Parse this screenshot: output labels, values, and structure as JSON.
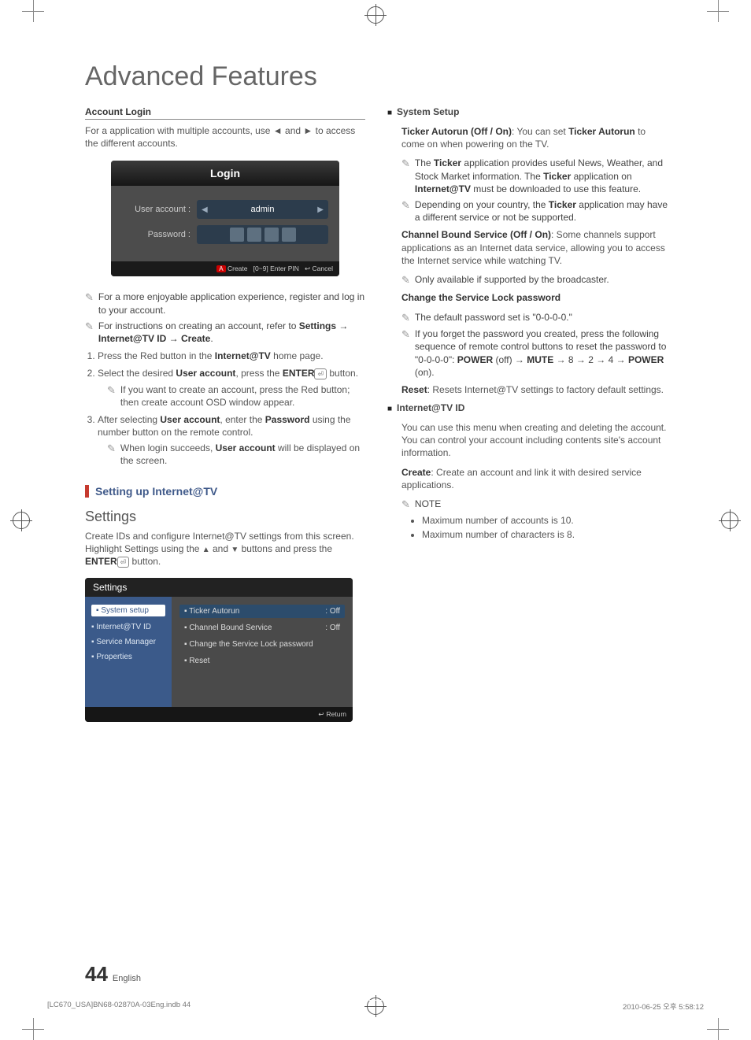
{
  "page_title": "Advanced Features",
  "left": {
    "account_login_heading": "Account Login",
    "account_login_intro_a": "For a application with multiple accounts, use ",
    "arrow_l": "◄",
    "account_login_intro_b": " and ",
    "arrow_r": "►",
    "account_login_intro_c": " to access the different accounts.",
    "login_box": {
      "title": "Login",
      "user_label": "User account :",
      "user_value": "admin",
      "pw_label": "Password :",
      "footer_a": "A",
      "footer_create": " Create",
      "footer_pin": "[0~9] Enter PIN",
      "footer_cancel_icon": "↩",
      "footer_cancel": " Cancel"
    },
    "notes": [
      "For a more enjoyable application experience, register and log in to your account.",
      "For instructions on creating an account, refer to Settings → Internet@TV ID → Create."
    ],
    "note2_bold": "Settings → Internet@TV ID → Create",
    "steps": {
      "s1_a": "Press the Red button in the ",
      "s1_b": "Internet@TV",
      "s1_c": " home page.",
      "s2_a": "Select the desired ",
      "s2_b": "User account",
      "s2_c": ", press the ",
      "s2_d": "ENTER",
      "s2_e": " button.",
      "s2_note": "If you want to create an account, press the Red button; then create account OSD window appear.",
      "s3_a": "After selecting ",
      "s3_b": "User account",
      "s3_c": ", enter the ",
      "s3_d": "Password",
      "s3_e": " using the number button on the remote control.",
      "s3_note_a": "When login succeeds, ",
      "s3_note_b": "User account",
      "s3_note_c": " will be displayed on the screen."
    },
    "section_header": "Setting up Internet@TV",
    "settings_title": "Settings",
    "settings_intro_a": "Create IDs and configure Internet@TV settings from this screen. Highlight Settings using the ",
    "up": "▲",
    "settings_intro_b": " and ",
    "dn": "▼",
    "settings_intro_c": " buttons and press the ",
    "settings_intro_d": "ENTER",
    "settings_intro_e": " button.",
    "settings_panel": {
      "header": "Settings",
      "nav": [
        "System setup",
        "Internet@TV ID",
        "Service Manager",
        "Properties"
      ],
      "rows": [
        {
          "label": "Ticker Autorun",
          "value": ": Off"
        },
        {
          "label": "Channel Bound Service",
          "value": ": Off"
        },
        {
          "label": "Change the Service Lock password",
          "value": ""
        },
        {
          "label": "Reset",
          "value": ""
        }
      ],
      "footer_return": "Return"
    }
  },
  "right": {
    "system_setup_heading": "System Setup",
    "ticker_a": "Ticker Autorun (Off / On)",
    "ticker_b": ": You can set ",
    "ticker_c": "Ticker Autorun",
    "ticker_d": " to come on when powering on the TV.",
    "ticker_note1_a": "The ",
    "ticker_note1_b": "Ticker",
    "ticker_note1_c": " application provides useful News, Weather, and Stock Market information. The ",
    "ticker_note1_d": "Ticker",
    "ticker_note1_e": " application on ",
    "ticker_note1_f": "Internet@TV",
    "ticker_note1_g": " must be downloaded to use this feature.",
    "ticker_note2_a": "Depending on your country, the ",
    "ticker_note2_b": "Ticker",
    "ticker_note2_c": " application may have a different service or not be supported.",
    "cbs_a": "Channel Bound Service (Off / On)",
    "cbs_b": ": Some channels support applications as an Internet data service, allowing you to access the Internet service while watching TV.",
    "cbs_note": "Only available if supported by the broadcaster.",
    "change_pw_heading": "Change the Service Lock password",
    "change_pw_note1": "The default password set is \"0-0-0-0.\"",
    "change_pw_note2_a": "If you forget the password you created, press the following sequence of remote control buttons to reset the password to \"0-0-0-0\": ",
    "change_pw_note2_b": "POWER",
    "change_pw_note2_c": " (off) → ",
    "change_pw_note2_d": "MUTE",
    "change_pw_note2_e": " → 8 → 2 → 4 → ",
    "change_pw_note2_f": "POWER",
    "change_pw_note2_g": " (on).",
    "reset_a": "Reset",
    "reset_b": ": Resets Internet@TV settings to factory default settings.",
    "internet_id_heading": "Internet@TV ID",
    "internet_id_body": "You can use this menu when creating and deleting the account. You can control your account including contents site's account information.",
    "create_a": "Create",
    "create_b": ": Create an account and link it with desired service applications.",
    "note_label": "NOTE",
    "bullets": [
      "Maximum number of accounts is 10.",
      "Maximum number of characters is 8."
    ]
  },
  "footer": {
    "page_number": "44",
    "language": "English",
    "doc_ref": "[LC670_USA]BN68-02870A-03Eng.indb   44",
    "timestamp": "2010-06-25   오후 5:58:12"
  }
}
